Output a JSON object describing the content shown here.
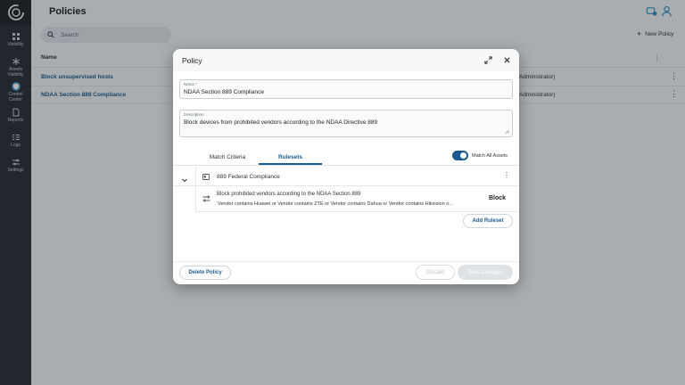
{
  "sidebar": {
    "items": [
      {
        "label": "Visibility",
        "icon": "grid-icon"
      },
      {
        "label": "Assets Visibility",
        "icon": "asterisk-icon"
      },
      {
        "label": "Control Center",
        "icon": "shield-icon",
        "active": true
      },
      {
        "label": "Reports",
        "icon": "document-icon"
      },
      {
        "label": "Logs",
        "icon": "logs-icon"
      },
      {
        "label": "Settings",
        "icon": "sliders-icon"
      }
    ]
  },
  "header": {
    "title": "Policies"
  },
  "search": {
    "placeholder": "Search"
  },
  "toolbar": {
    "new_policy_label": "New Policy"
  },
  "table": {
    "columns": [
      "Name"
    ],
    "rows": [
      {
        "name": "Block unsupervised hosts",
        "role": "Administrator)"
      },
      {
        "name": "NDAA Section 889 Compliance",
        "role": "Administrator)"
      }
    ]
  },
  "modal": {
    "title": "Policy",
    "name_label": "Name *",
    "name_value": "NDAA Section 889 Compliance",
    "description_label": "Description",
    "description_value": "Block devices from prohibited vendors according to the NDAA Directive 889",
    "tabs": [
      "Match Criteria",
      "Rulesets"
    ],
    "active_tab": "Rulesets",
    "match_all_label": "Match All Assets",
    "ruleset": {
      "name": "889 Federal Compliance",
      "rule": {
        "title": "Block prohibited vendors according to the NDAA Section 889",
        "conditions": "Vendor  contains Huawei or Vendor  contains ZTE or Vendor  contains Dahua or Vendor  contains Hikvision o...",
        "action": "Block"
      }
    },
    "add_ruleset_label": "Add Ruleset",
    "delete_label": "Delete Policy",
    "discard_label": "Discard",
    "save_label": "Save Changes"
  },
  "colors": {
    "accent": "#1c5b8d",
    "sidebar": "#2a2f36",
    "toggle_active": "#1c5b8d"
  }
}
